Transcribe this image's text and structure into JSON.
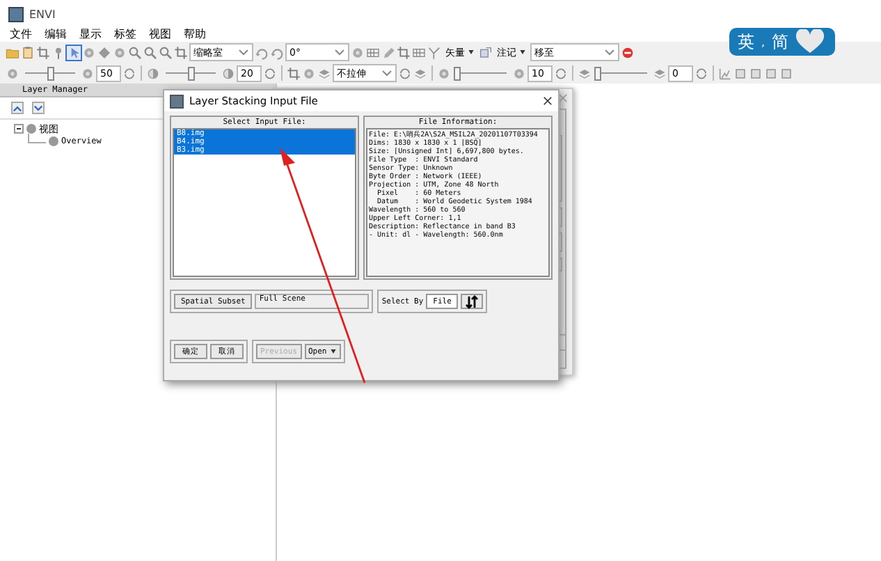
{
  "window": {
    "title": "ENVI"
  },
  "menu": [
    "文件",
    "编辑",
    "显示",
    "标签",
    "视图",
    "帮助"
  ],
  "toolbar_1": [
    {
      "kind": "combo",
      "value": "缩略室"
    },
    {
      "kind": "combo",
      "value": "0°"
    },
    {
      "kind": "dropdown",
      "label": "矢量"
    },
    {
      "kind": "dropdown",
      "label": "注记"
    },
    {
      "kind": "combo",
      "value": "移至"
    }
  ],
  "toolbar_2": [
    {
      "kind": "slider",
      "level": 0.5
    },
    {
      "kind": "field",
      "value": "50"
    },
    {
      "kind": "slider",
      "level": 0.5
    },
    {
      "kind": "field",
      "value": "20"
    },
    {
      "kind": "combo",
      "value": "不拉伸"
    },
    {
      "kind": "slider",
      "level": 0
    },
    {
      "kind": "field",
      "value": "10"
    },
    {
      "kind": "slider",
      "level": 0
    },
    {
      "kind": "field",
      "value": "0"
    }
  ],
  "ime": {
    "mode": "英",
    "punct": ",",
    "script": "简"
  },
  "layer_manager": {
    "title": "Layer Manager",
    "tree": [
      {
        "label": "视图",
        "expanded": true,
        "children": [
          {
            "label": "Overview"
          }
        ]
      }
    ]
  },
  "dialog": {
    "title": "Layer Stacking Input File",
    "files_heading": "Select Input File:",
    "files": [
      {
        "name": "B8.img",
        "selected": true
      },
      {
        "name": "B4.img",
        "selected": true
      },
      {
        "name": "B3.img",
        "selected": true
      }
    ],
    "info_heading": "File Information:",
    "info": [
      "File: E:\\哨兵2A\\S2A_MSIL2A_20201107T03394",
      "Dims: 1830 x 1830 x 1 [BSQ]",
      "Size: [Unsigned Int] 6,697,800 bytes.",
      "File Type  : ENVI Standard",
      "Sensor Type: Unknown",
      "Byte Order : Network (IEEE)",
      "Projection : UTM, Zone 48 North",
      "  Pixel    : 60 Meters",
      "  Datum    : World Geodetic System 1984",
      "Wavelength : 560 to 560",
      "Upper Left Corner: 1,1",
      "Description: Reflectance in band B3",
      "- Unit: dl - Wavelength: 560.0nm"
    ],
    "subset_button": "Spatial Subset",
    "subset_value": "Full Scene",
    "select_by_label": "Select By",
    "select_by_value": "File",
    "buttons": [
      {
        "label": "确定",
        "disabled": false,
        "menu": false
      },
      {
        "label": "取消",
        "disabled": false,
        "menu": false
      },
      {
        "label": "Previous",
        "disabled": true,
        "menu": false
      },
      {
        "label": "Open",
        "disabled": false,
        "menu": true
      }
    ]
  }
}
